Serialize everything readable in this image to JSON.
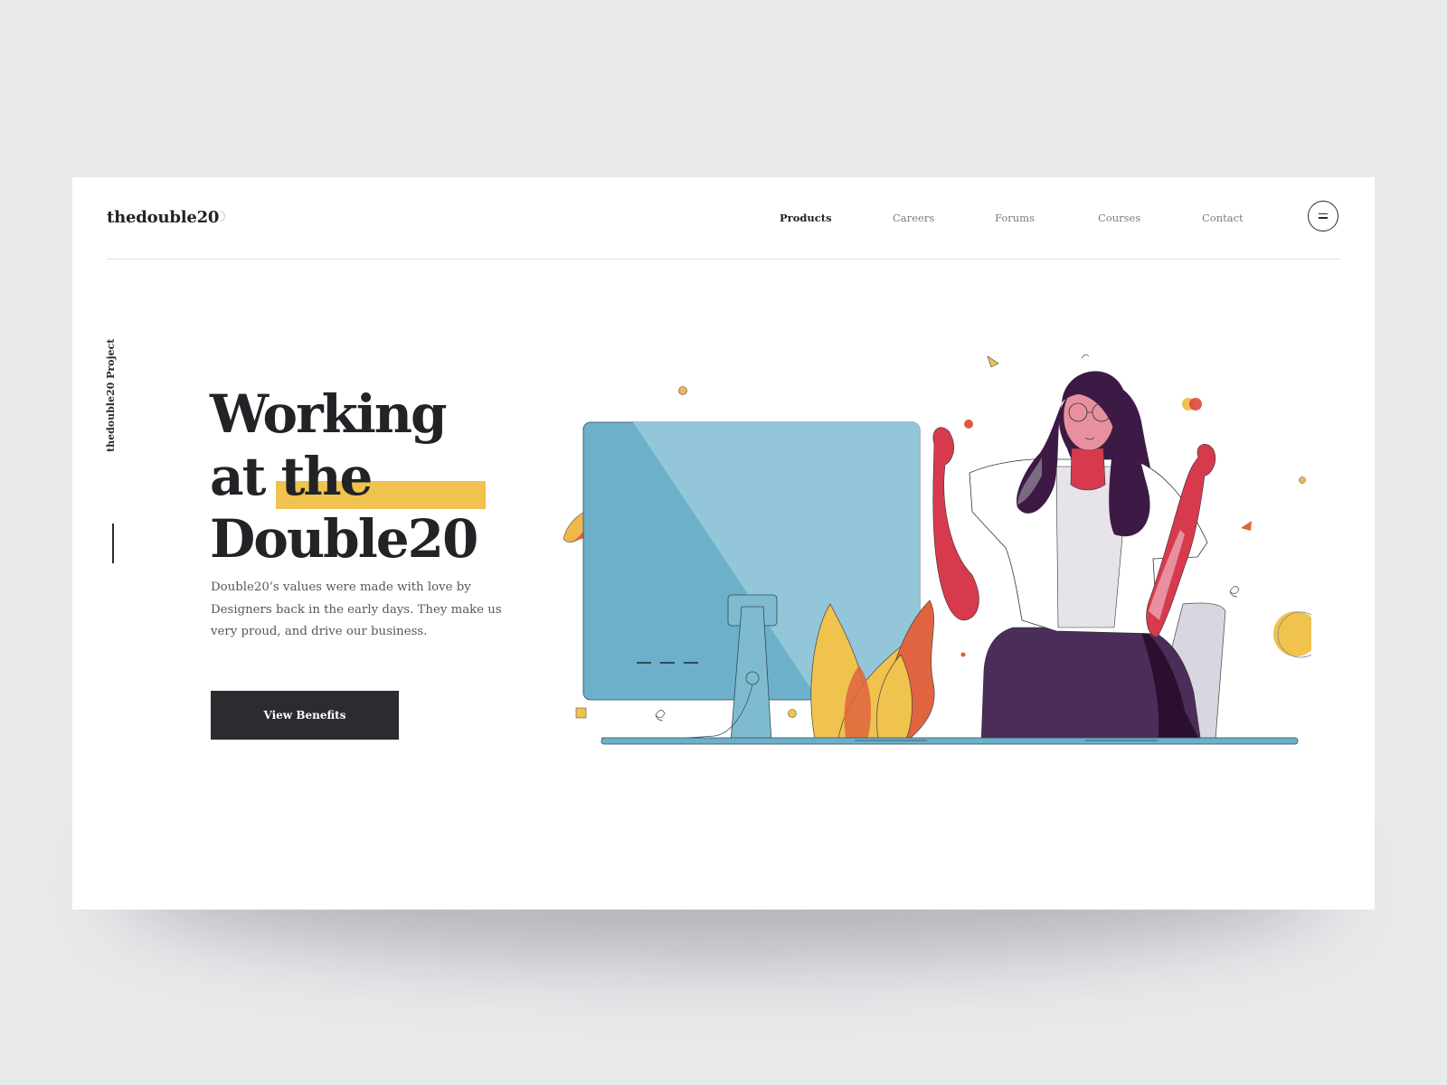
{
  "header": {
    "logo": "thedouble20",
    "nav": [
      {
        "label": "Products",
        "active": true
      },
      {
        "label": "Careers",
        "active": false
      },
      {
        "label": "Forums",
        "active": false
      },
      {
        "label": "Courses",
        "active": false
      },
      {
        "label": "Contact",
        "active": false
      }
    ],
    "menu_icon": "hamburger-menu-icon"
  },
  "side_label": "thedouble20 Project",
  "hero": {
    "headline_lines": [
      "Working",
      "at the",
      "Double20"
    ],
    "highlighted_words": "the",
    "description": "Double20’s values were made with love by Designers back in the early days. They make us very proud, and drive our business.",
    "cta_label": "View Benefits"
  },
  "colors": {
    "page_background": "#e8e9eb",
    "card_background": "#ffffff",
    "text_dark": "#222326",
    "highlight_yellow": "#f0c24e",
    "button_dark": "#2b2c2f",
    "monitor_blue": "#6cb0c9",
    "accent_red": "#d83a4d",
    "hair_purple": "#3d1a45"
  },
  "illustration": "woman-celebrating-at-desk-with-monitor-and-plants"
}
